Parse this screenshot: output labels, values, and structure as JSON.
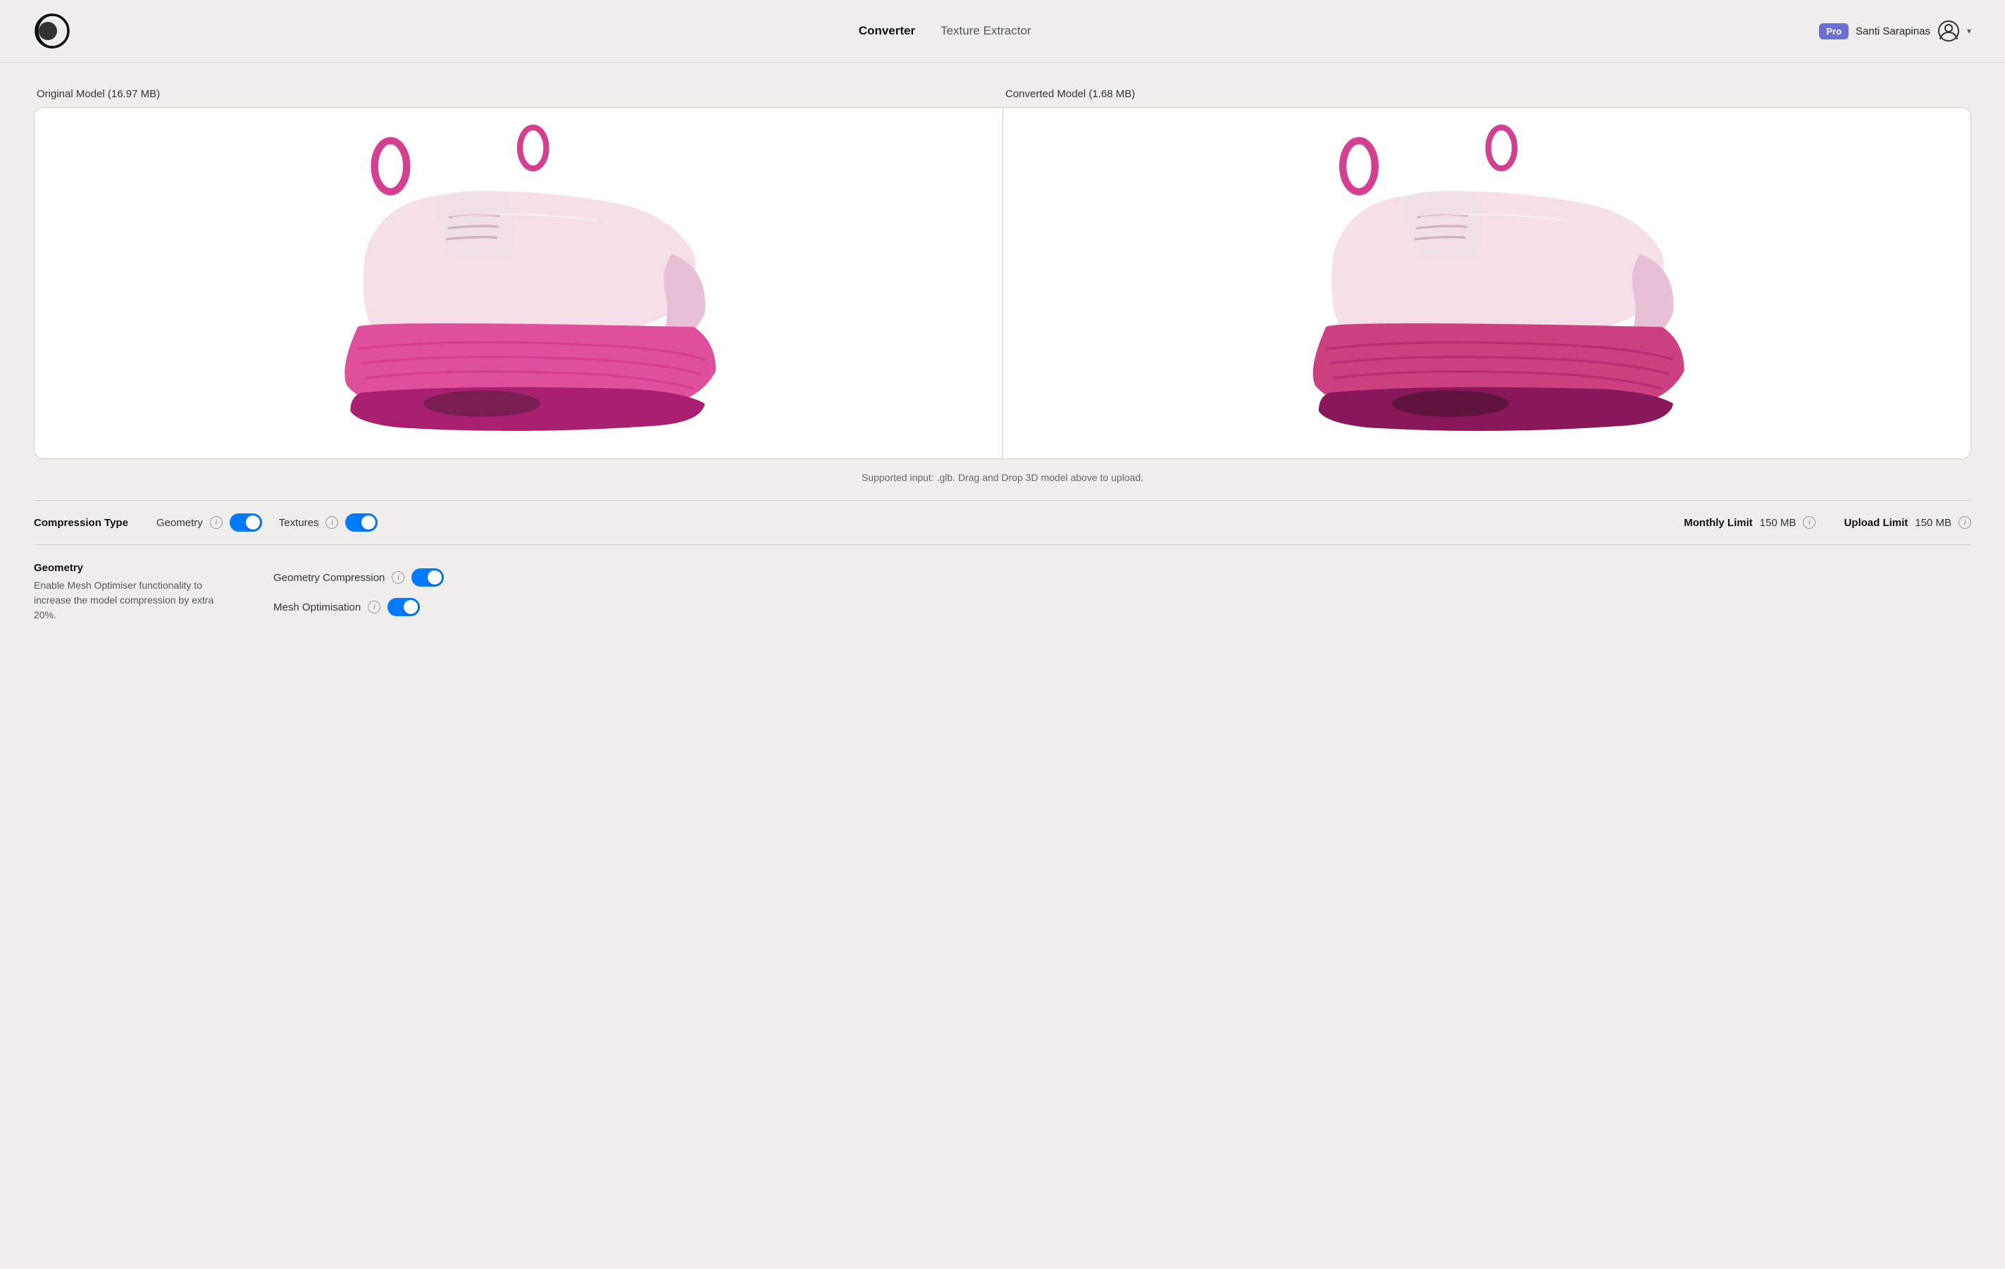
{
  "app": {
    "logo_alt": "App Logo"
  },
  "header": {
    "nav": [
      {
        "id": "converter",
        "label": "Converter",
        "active": true
      },
      {
        "id": "texture-extractor",
        "label": "Texture Extractor",
        "active": false
      }
    ],
    "user": {
      "pro_badge": "Pro",
      "name": "Santi Sarapinas",
      "chevron": "▾"
    }
  },
  "panels": {
    "original": {
      "label": "Original Model (16.97 MB)"
    },
    "converted": {
      "label": "Converted Model (1.68 MB)"
    }
  },
  "support_text": "Supported input: .glb. Drag and Drop 3D model above to upload.",
  "controls": {
    "compression_type_label": "Compression Type",
    "geometry_label": "Geometry",
    "geometry_info": "i",
    "geometry_toggle": true,
    "textures_label": "Textures",
    "textures_info": "i",
    "textures_toggle": true,
    "monthly_limit_label": "Monthly Limit",
    "monthly_limit_value": "150 MB",
    "monthly_limit_info": "i",
    "upload_limit_label": "Upload Limit",
    "upload_limit_value": "150 MB",
    "upload_limit_info": "i"
  },
  "geometry_section": {
    "title": "Geometry",
    "description": "Enable Mesh Optimiser functionality to increase the model compression by extra 20%.",
    "geometry_compression_label": "Geometry Compression",
    "geometry_compression_info": "i",
    "geometry_compression_toggle": true,
    "mesh_optimisation_label": "Mesh Optimisation",
    "mesh_optimisation_info": "i",
    "mesh_optimisation_toggle": true
  }
}
